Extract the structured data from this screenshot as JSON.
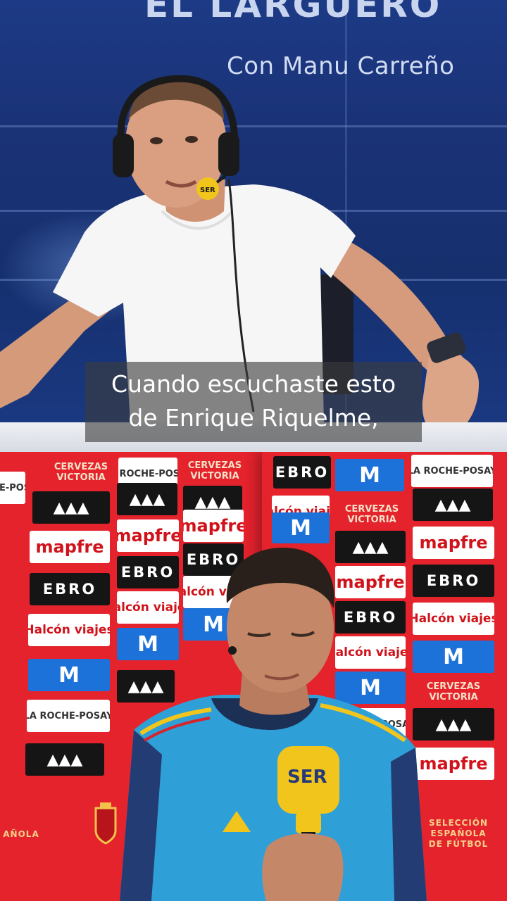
{
  "studio": {
    "show_title": "EL LARGUERO",
    "show_subtitle": "Con Manu Carreño",
    "mic_brand": "SER"
  },
  "caption": {
    "line1": "Cuando escuchaste esto",
    "line2": "de Enrique Riquelme,"
  },
  "press": {
    "sponsors": {
      "ebro": "EBRO",
      "mapfre": "mapfre",
      "halcon": "Halcón viajes",
      "movistar": "M",
      "adidas": "▲▲▲",
      "laroche": "LA ROCHE-POSAY",
      "victoria_1": "CERVEZAS",
      "victoria_2": "VICTORIA"
    },
    "seleccion_1": "SELECCIÓN ESPAÑOLA",
    "seleccion_2": "DE FÚTBOL",
    "espanola": "AÑOLA",
    "mic_brand": "SER"
  },
  "colors": {
    "studio_blue": "#1a3276",
    "backdrop_red": "#e3222c",
    "jersey_blue": "#2f9fd8",
    "mic_yellow": "#f2c51c"
  }
}
